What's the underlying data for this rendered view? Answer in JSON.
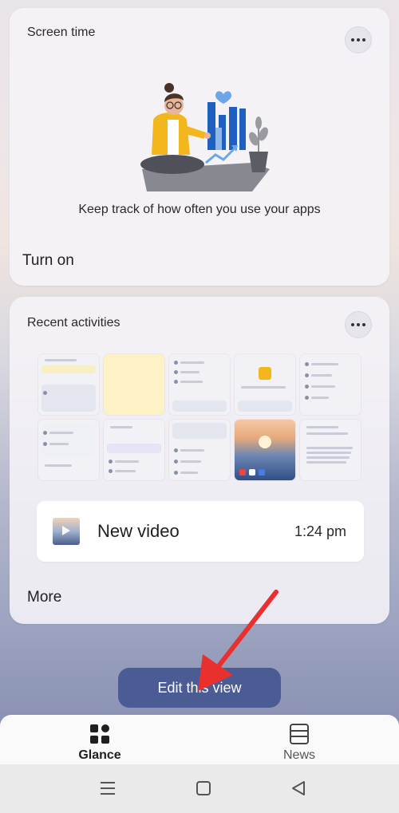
{
  "screen_time": {
    "title": "Screen time",
    "description": "Keep track of how often you use your apps",
    "action": "Turn on"
  },
  "recent": {
    "title": "Recent activities",
    "latest_item": {
      "title": "New video",
      "time": "1:24 pm"
    },
    "more_label": "More"
  },
  "edit_button_label": "Edit this view",
  "bottom_nav": {
    "tabs": [
      {
        "label": "Glance",
        "icon": "grid-icon",
        "active": true
      },
      {
        "label": "News",
        "icon": "newspaper-icon",
        "active": false
      }
    ]
  },
  "system_nav": [
    "recents-icon",
    "home-icon",
    "back-icon"
  ],
  "colors": {
    "accent_button": "#4b5b93",
    "annotation_arrow": "#e8312f",
    "illustration_blue": "#1f5fbf",
    "illustration_yellow": "#f2b71c"
  }
}
